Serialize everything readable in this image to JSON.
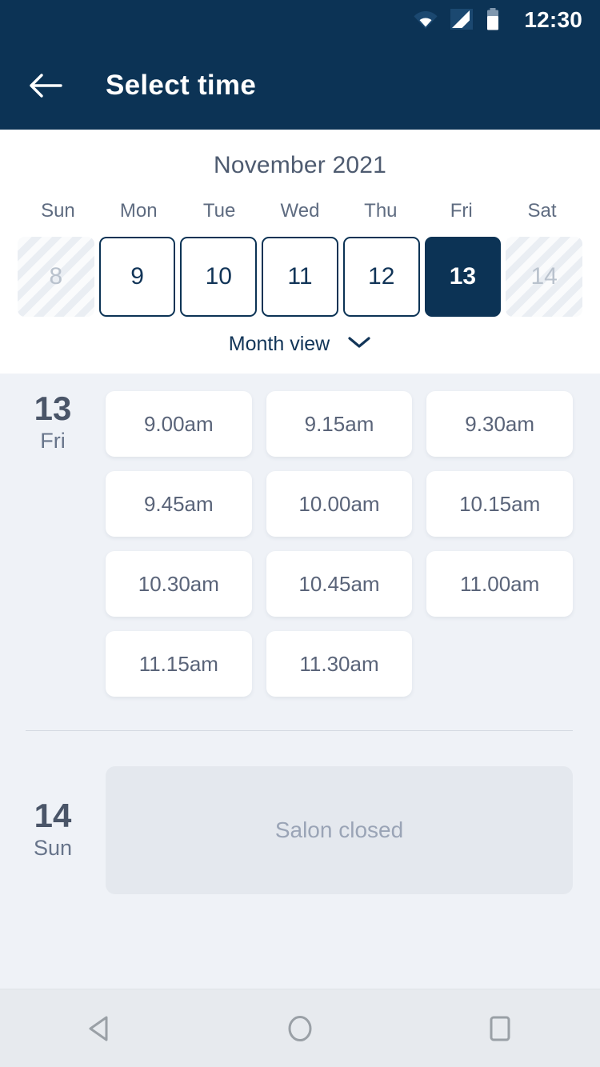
{
  "statusbar": {
    "time": "12:30",
    "icons": [
      "wifi-icon",
      "signal-icon",
      "battery-icon"
    ]
  },
  "appbar": {
    "title": "Select time",
    "back_icon": "back-arrow-icon"
  },
  "calendar": {
    "month_title": "November 2021",
    "weekdays": [
      "Sun",
      "Mon",
      "Tue",
      "Wed",
      "Thu",
      "Fri",
      "Sat"
    ],
    "dates": [
      {
        "day": "8",
        "state": "disabled"
      },
      {
        "day": "9",
        "state": "available"
      },
      {
        "day": "10",
        "state": "available"
      },
      {
        "day": "11",
        "state": "available"
      },
      {
        "day": "12",
        "state": "available"
      },
      {
        "day": "13",
        "state": "selected"
      },
      {
        "day": "14",
        "state": "disabled"
      }
    ],
    "view_toggle_label": "Month view",
    "view_toggle_icon": "chevron-down-icon"
  },
  "days": [
    {
      "date_number": "13",
      "weekday": "Fri",
      "slots": [
        "9.00am",
        "9.15am",
        "9.30am",
        "9.45am",
        "10.00am",
        "10.15am",
        "10.30am",
        "10.45am",
        "11.00am",
        "11.15am",
        "11.30am"
      ],
      "closed_label": null
    },
    {
      "date_number": "14",
      "weekday": "Sun",
      "slots": [],
      "closed_label": "Salon closed"
    }
  ],
  "navbar": {
    "back_label": "back-triangle-icon",
    "home_label": "home-circle-icon",
    "recents_label": "recents-square-icon"
  },
  "colors": {
    "brand_navy": "#0c3355",
    "body_bg": "#eff2f7",
    "slot_text": "#5a6479",
    "muted_text": "#9aa4b6",
    "closed_panel": "#e4e8ee"
  }
}
